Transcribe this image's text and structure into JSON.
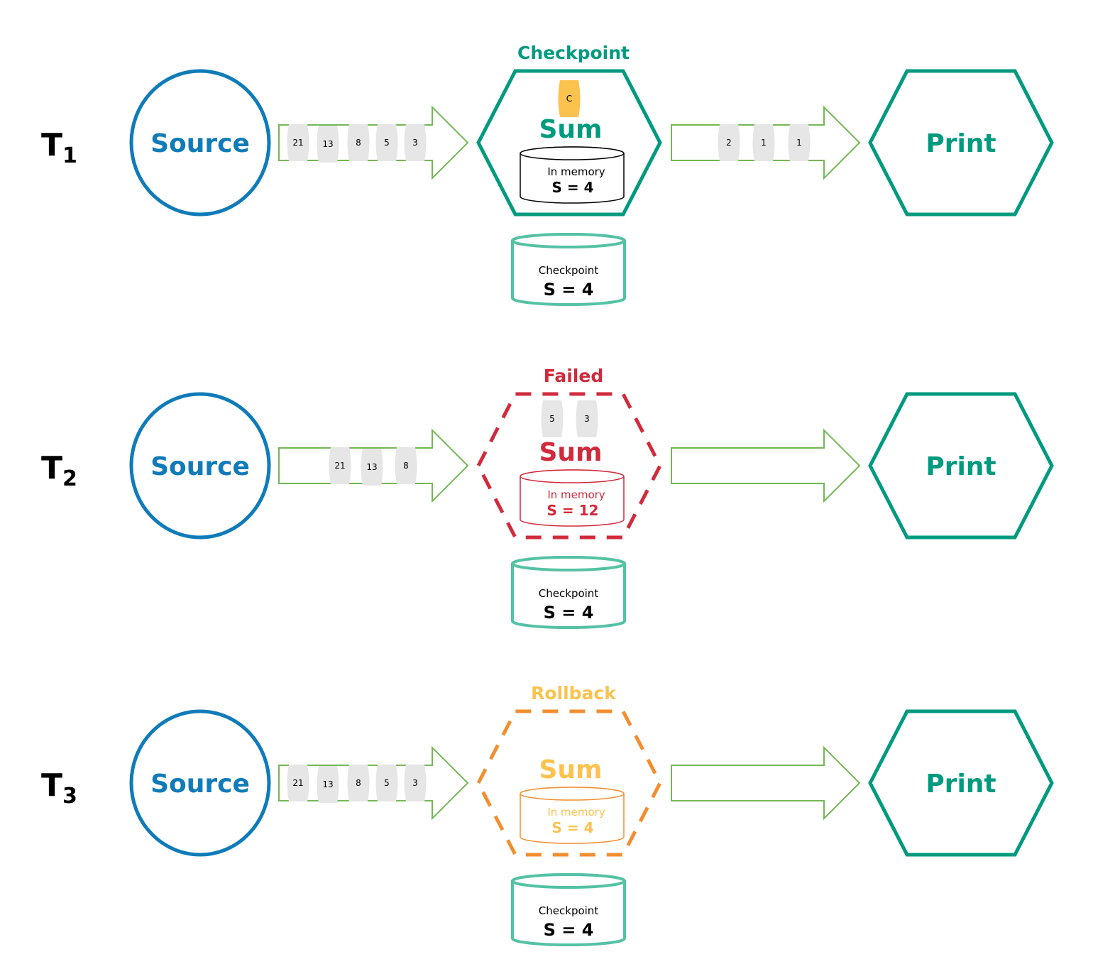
{
  "colors": {
    "source": "#0f7bb9",
    "operator_ok": "#009a7e",
    "failed": "#d12a3c",
    "rollback_text": "#fcc24e",
    "rollback_stroke": "#f28e30",
    "arrow": "#73b855",
    "record_fill": "#e6e6e6",
    "checkpoint_store": "#55c1a5",
    "checkpoint_barrier": "#fcc24e",
    "black": "#000000"
  },
  "rows": [
    {
      "time_label": "T",
      "time_sub": "1",
      "source_label": "Source",
      "input_records": [
        "21",
        "13",
        "8",
        "5",
        "3"
      ],
      "operator": {
        "status_label": "Checkpoint",
        "status": "ok",
        "name": "Sum",
        "barrier": "C",
        "inside_records": [],
        "memory_label": "In memory",
        "memory_value": "S = 4"
      },
      "output_records": [
        "2",
        "1",
        "1"
      ],
      "sink_label": "Print",
      "checkpoint_store": {
        "label": "Checkpoint",
        "value": "S = 4"
      }
    },
    {
      "time_label": "T",
      "time_sub": "2",
      "source_label": "Source",
      "input_records": [
        "21",
        "13",
        "8"
      ],
      "operator": {
        "status_label": "Failed",
        "status": "failed",
        "name": "Sum",
        "barrier": null,
        "inside_records": [
          "5",
          "3"
        ],
        "memory_label": "In memory",
        "memory_value": "S = 12"
      },
      "output_records": [],
      "sink_label": "Print",
      "checkpoint_store": {
        "label": "Checkpoint",
        "value": "S = 4"
      }
    },
    {
      "time_label": "T",
      "time_sub": "3",
      "source_label": "Source",
      "input_records": [
        "21",
        "13",
        "8",
        "5",
        "3"
      ],
      "operator": {
        "status_label": "Rollback",
        "status": "rollback",
        "name": "Sum",
        "barrier": null,
        "inside_records": [],
        "memory_label": "In memory",
        "memory_value": "S = 4"
      },
      "output_records": [],
      "sink_label": "Print",
      "checkpoint_store": {
        "label": "Checkpoint",
        "value": "S = 4"
      }
    }
  ]
}
